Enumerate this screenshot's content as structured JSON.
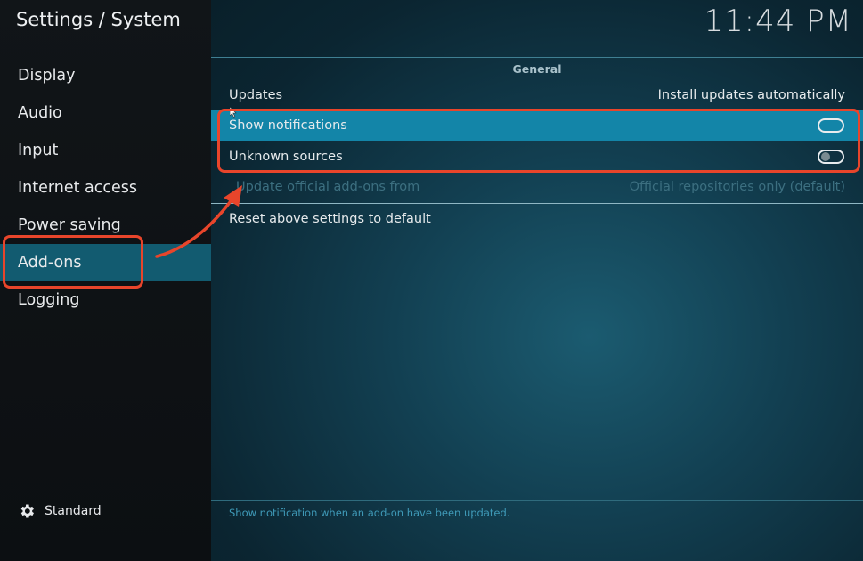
{
  "header": {
    "title": "Settings / System",
    "clock": "11:44 PM"
  },
  "sidebar": {
    "items": [
      {
        "label": "Display"
      },
      {
        "label": "Audio"
      },
      {
        "label": "Input"
      },
      {
        "label": "Internet access"
      },
      {
        "label": "Power saving"
      },
      {
        "label": "Add-ons",
        "active": true
      },
      {
        "label": "Logging"
      }
    ],
    "level_label": "Standard",
    "level_icon": "gear-icon"
  },
  "main": {
    "section_title": "General",
    "settings": {
      "updates": {
        "label": "Updates",
        "value": "Install updates automatically"
      },
      "show_notifications": {
        "label": "Show notifications",
        "state": "on"
      },
      "unknown_sources": {
        "label": "Unknown sources",
        "state": "off"
      },
      "update_from": {
        "label": "Update official add-ons from",
        "value": "Official repositories only (default)",
        "disabled": true
      },
      "reset": {
        "label": "Reset above settings to default"
      }
    },
    "hint": "Show notification when an add-on have been updated."
  },
  "colors": {
    "focus": "#1385a8",
    "sidebar_active": "#125b70",
    "annotation": "#e8452b"
  }
}
